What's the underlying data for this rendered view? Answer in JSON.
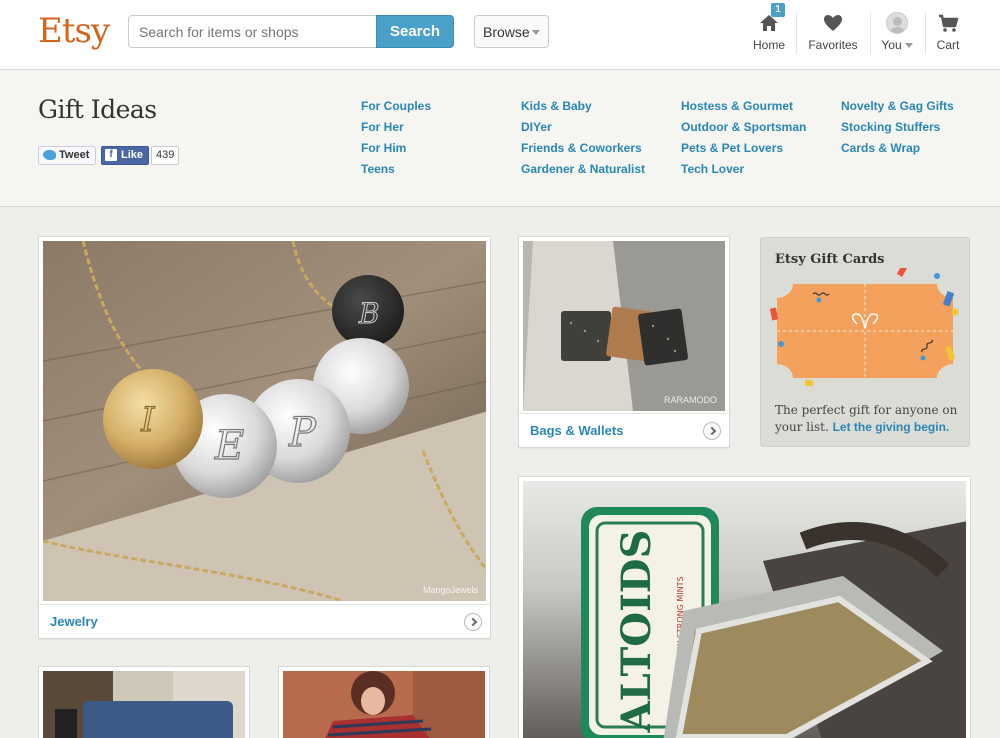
{
  "header": {
    "logo": "Etsy",
    "search_placeholder": "Search for items or shops",
    "search_button": "Search",
    "browse_label": "Browse",
    "nav": {
      "home": "Home",
      "home_badge": "1",
      "favorites": "Favorites",
      "you": "You",
      "cart": "Cart"
    }
  },
  "gift": {
    "title": "Gift Ideas",
    "tweet_label": "Tweet",
    "like_label": "Like",
    "like_count": "439",
    "categories": [
      [
        "For Couples",
        "For Her",
        "For Him",
        "Teens"
      ],
      [
        "Kids & Baby",
        "DIYer",
        "Friends & Coworkers",
        "Gardener & Naturalist"
      ],
      [
        "Hostess & Gourmet",
        "Outdoor & Sportsman",
        "Pets & Pet Lovers",
        "Tech Lover"
      ],
      [
        "Novelty & Gag Gifts",
        "Stocking Stuffers",
        "Cards & Wrap"
      ]
    ]
  },
  "tiles": {
    "jewelry": {
      "label": "Jewelry",
      "credit": "MangoJewels"
    },
    "bags": {
      "label": "Bags & Wallets",
      "credit": "RARAMODO"
    },
    "tin_brand": "ALTOIDS",
    "tin_subtitle": "CURIOUSLY STRONG MINTS"
  },
  "gift_cards": {
    "title": "Etsy Gift Cards",
    "text": "The perfect gift for anyone on your list.",
    "link": "Let the giving begin."
  },
  "colors": {
    "brand": "#d5641c",
    "link": "#2a87b5",
    "search": "#4aa0c8"
  }
}
